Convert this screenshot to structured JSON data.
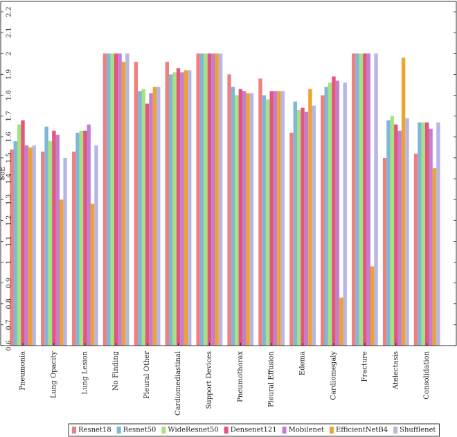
{
  "chart_data": {
    "type": "bar",
    "title": "",
    "xlabel": "",
    "ylabel": "SoE",
    "ylim": [
      0.6,
      2.25
    ],
    "yticks": [
      "0.6",
      "0.7",
      "0.8",
      "0.9",
      "1",
      "1.1",
      "1.2",
      "1.3",
      "1.4",
      "1.5",
      "1.6",
      "1.7",
      "1.8",
      "1.9",
      "2",
      "2.1",
      "2.2"
    ],
    "grid": false,
    "legend_position": "bottom",
    "categories": [
      "Pneumonia",
      "Lung Opacity",
      "Lung Lesion",
      "No Finding",
      "Pleural Other",
      "Cardiomediastinal",
      "Support Devices",
      "Pneumothorax",
      "Pleural Effusion",
      "Edema",
      "Cardiomegaly",
      "Fracture",
      "Atelectasis",
      "Consolidation"
    ],
    "series": [
      {
        "name": "Resnet18",
        "color": "#f07f7f",
        "values": [
          1.54,
          1.53,
          1.53,
          2.0,
          1.96,
          1.96,
          2.0,
          1.9,
          1.88,
          1.62,
          1.8,
          2.0,
          1.5,
          1.52
        ]
      },
      {
        "name": "Resnet50",
        "color": "#7fb7d8",
        "values": [
          1.58,
          1.65,
          1.62,
          2.0,
          1.82,
          1.9,
          2.0,
          1.84,
          1.8,
          1.77,
          1.84,
          2.0,
          1.68,
          1.67
        ]
      },
      {
        "name": "WideResnet50",
        "color": "#a6e27f",
        "values": [
          1.66,
          1.58,
          1.63,
          2.0,
          1.83,
          1.91,
          2.0,
          1.8,
          1.78,
          1.73,
          1.86,
          2.0,
          1.7,
          1.67
        ]
      },
      {
        "name": "Densenet121",
        "color": "#e3557e",
        "values": [
          1.68,
          1.63,
          1.63,
          2.0,
          1.76,
          1.93,
          2.0,
          1.83,
          1.82,
          1.74,
          1.89,
          2.0,
          1.66,
          1.67
        ]
      },
      {
        "name": "Mobilenet",
        "color": "#c27fd0",
        "values": [
          1.56,
          1.61,
          1.66,
          2.0,
          1.81,
          1.91,
          2.0,
          1.82,
          1.82,
          1.72,
          1.87,
          2.0,
          1.63,
          1.64
        ]
      },
      {
        "name": "EfficientNetB4",
        "color": "#eea232",
        "values": [
          1.55,
          1.3,
          1.28,
          1.96,
          1.84,
          1.92,
          2.0,
          1.81,
          1.82,
          1.83,
          0.83,
          0.98,
          1.98,
          1.45
        ]
      },
      {
        "name": "Shufflenet",
        "color": "#b8b6e2",
        "values": [
          1.56,
          1.5,
          1.56,
          2.0,
          1.84,
          1.92,
          2.0,
          1.81,
          1.82,
          1.75,
          1.86,
          2.0,
          1.69,
          1.67
        ]
      }
    ]
  }
}
